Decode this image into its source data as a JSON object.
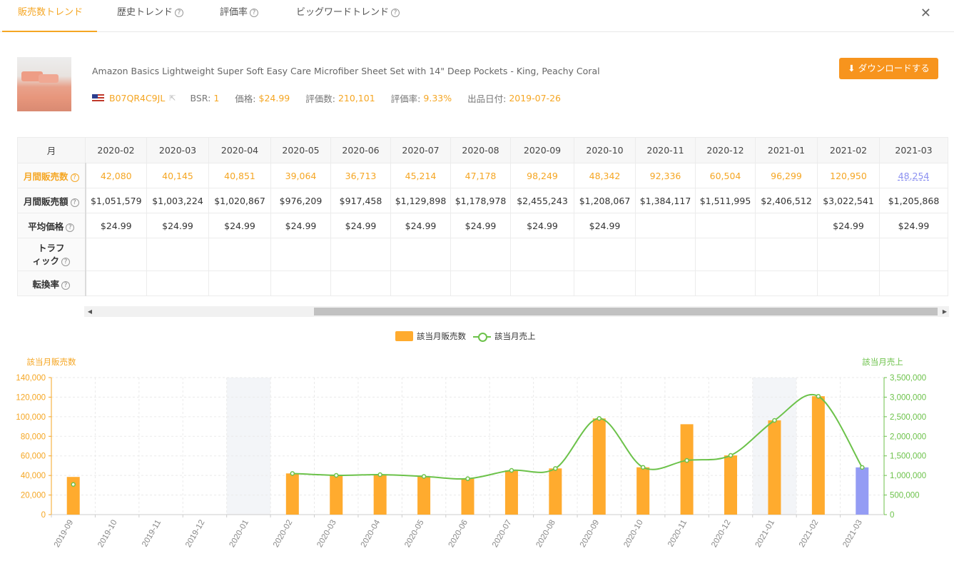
{
  "tabs": [
    {
      "label": "販売数トレンド",
      "help": false
    },
    {
      "label": "歴史トレンド",
      "help": true
    },
    {
      "label": "評価率",
      "help": true
    },
    {
      "label": "ビッグワードトレンド",
      "help": true
    }
  ],
  "close_label": "✕",
  "product": {
    "title": "Amazon Basics Lightweight Super Soft Easy Care Microfiber Sheet Set with 14\" Deep Pockets - King, Peachy Coral",
    "asin": "B07QR4C9JL",
    "bsr_label": "BSR:",
    "bsr": "1",
    "price_label": "価格:",
    "price": "$24.99",
    "reviews_label": "評価数:",
    "reviews": "210,101",
    "rating_rate_label": "評価率:",
    "rating_rate": "9.33%",
    "listed_label": "出品日付:",
    "listed": "2019-07-26"
  },
  "download_label": "ダウンロードする",
  "table": {
    "month_header": "月",
    "months": [
      "2020-02",
      "2020-03",
      "2020-04",
      "2020-05",
      "2020-06",
      "2020-07",
      "2020-08",
      "2020-09",
      "2020-10",
      "2020-11",
      "2020-12",
      "2021-01",
      "2021-02",
      "2021-03"
    ],
    "rows": [
      {
        "label": "月間販売数",
        "values": [
          "42,080",
          "40,145",
          "40,851",
          "39,064",
          "36,713",
          "45,214",
          "47,178",
          "98,249",
          "48,342",
          "92,336",
          "60,504",
          "96,299",
          "120,950",
          "48,254"
        ]
      },
      {
        "label": "月間販売額",
        "values": [
          "$1,051,579",
          "$1,003,224",
          "$1,020,867",
          "$976,209",
          "$917,458",
          "$1,129,898",
          "$1,178,978",
          "$2,455,243",
          "$1,208,067",
          "$1,384,117",
          "$1,511,995",
          "$2,406,512",
          "$3,022,541",
          "$1,205,868"
        ]
      },
      {
        "label": "平均価格",
        "values": [
          "$24.99",
          "$24.99",
          "$24.99",
          "$24.99",
          "$24.99",
          "$24.99",
          "$24.99",
          "$24.99",
          "$24.99",
          "",
          "",
          "",
          "$24.99",
          "$24.99"
        ]
      },
      {
        "label_line1": "トラフ",
        "label_line2": "ィック",
        "values": [
          "",
          "",
          "",
          "",
          "",
          "",
          "",
          "",
          "",
          "",
          "",
          "",
          "",
          ""
        ]
      },
      {
        "label": "転換率",
        "values": [
          "",
          "",
          "",
          "",
          "",
          "",
          "",
          "",
          "",
          "",
          "",
          "",
          "",
          ""
        ]
      }
    ]
  },
  "legend": {
    "bar": "該当月販売数",
    "line": "該当月売上"
  },
  "chart_data": {
    "type": "bar",
    "categories": [
      "2019-09",
      "2019-10",
      "2019-11",
      "2019-12",
      "2020-01",
      "2020-02",
      "2020-03",
      "2020-04",
      "2020-05",
      "2020-06",
      "2020-07",
      "2020-08",
      "2020-09",
      "2020-10",
      "2020-11",
      "2020-12",
      "2021-01",
      "2021-02",
      "2021-03"
    ],
    "series": [
      {
        "name": "該当月販売数",
        "axis": "left",
        "kind": "bar",
        "color": "#ffab2e",
        "values": [
          38500,
          0,
          0,
          0,
          0,
          42080,
          40145,
          40851,
          39064,
          36713,
          45214,
          47178,
          98249,
          48342,
          92336,
          60504,
          96299,
          120950,
          48254
        ]
      },
      {
        "name": "該当月売上",
        "axis": "right",
        "kind": "line",
        "color": "#6cc24a",
        "values": [
          770000,
          null,
          null,
          null,
          null,
          1051579,
          1003224,
          1020867,
          976209,
          917458,
          1129898,
          1178978,
          2455243,
          1208067,
          1384117,
          1511995,
          2406512,
          3022541,
          1205868
        ]
      }
    ],
    "highlight_bar": {
      "index": 18,
      "color": "#949cf4"
    },
    "shaded_categories": [
      "2020-01",
      "2021-01"
    ],
    "ylabel": "該当月販売数",
    "y2label": "該当月売上",
    "ylim": [
      0,
      140000
    ],
    "y2lim": [
      0,
      3500000
    ],
    "yticks": [
      "0",
      "20,000",
      "40,000",
      "60,000",
      "80,000",
      "100,000",
      "120,000",
      "140,000"
    ],
    "y2ticks": [
      "0",
      "500,000",
      "1,000,000",
      "1,500,000",
      "2,000,000",
      "2,500,000",
      "3,000,000",
      "3,500,000"
    ],
    "grid": true,
    "legend_position": "top-center"
  }
}
